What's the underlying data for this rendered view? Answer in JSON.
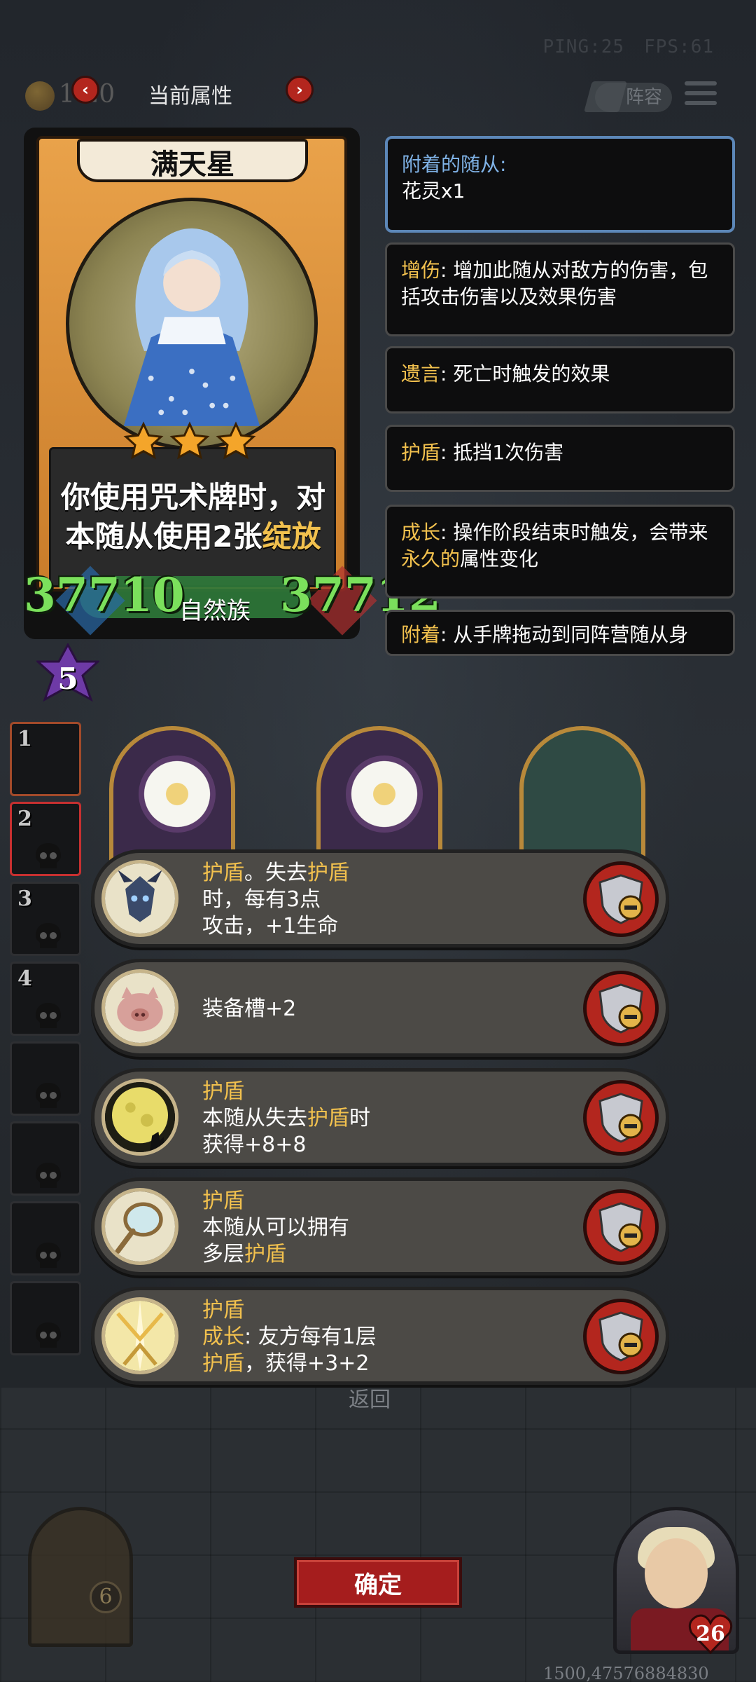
{
  "topbar": {
    "ping_label": "PING:25",
    "fps_label": "FPS:61",
    "coin_text": "1 20",
    "panel_title": "当前属性",
    "lineup_label": "阵容"
  },
  "card": {
    "name": "满天星",
    "stars": 3,
    "desc_line1": "你使用咒术牌时，对",
    "desc_line2_pre": "本随从使用2张",
    "desc_line2_hl": "绽放",
    "attack": "37710",
    "health": "37712",
    "tribe": "自然族"
  },
  "keywords": {
    "attached_title": "附着的随从:",
    "attached_value": "花灵x1",
    "damage_key": "增伤",
    "damage_desc": ": 增加此随从对敌方的伤害，包括攻击伤害以及效果伤害",
    "deathrattle_key": "遗言",
    "deathrattle_desc": ": 死亡时触发的效果",
    "shield_key": "护盾",
    "shield_desc": ": 抵挡1次伤害",
    "growth_key": "成长",
    "growth_desc_pre": ": 操作阶段结束时触发，会带来",
    "growth_desc_hl": "永久的",
    "growth_desc_post": "属性变化",
    "attach_key": "附着",
    "attach_desc": ": 从手牌拖动到同阵营随从身"
  },
  "level": "5",
  "slots": [
    {
      "num": "1"
    },
    {
      "num": "2"
    },
    {
      "num": "3"
    },
    {
      "num": "4"
    },
    {
      "num": ""
    },
    {
      "num": ""
    },
    {
      "num": ""
    },
    {
      "num": ""
    }
  ],
  "buffs": [
    {
      "icon": "demon-mask-icon",
      "l1_a": "护盾",
      "l1_b": "。失去",
      "l1_c": "护盾",
      "l2": "时，每有3点",
      "l3": "攻击，+1生命"
    },
    {
      "icon": "pig-icon",
      "l1": "装备槽+2"
    },
    {
      "icon": "moon-icon",
      "l1": "护盾",
      "l2_a": "本随从失去",
      "l2_b": "护盾",
      "l2_c": "时",
      "l3": "获得+8+8"
    },
    {
      "icon": "mirror-icon",
      "l1": "护盾",
      "l2": "本随从可以拥有",
      "l3_a": "多层",
      "l3_b": "护盾"
    },
    {
      "icon": "light-sword-icon",
      "l1": "护盾",
      "l2_a": "成长",
      "l2_b": ": 友方每有1层",
      "l3_a": "护盾",
      "l3_b": "，获得+3+2"
    }
  ],
  "back_label": "返回",
  "confirm_label": "确定",
  "door_count": "6",
  "hero_hp": "26",
  "coords_text": "1500,47576884830",
  "colors": {
    "highlight": "#f2c14e",
    "stat_green": "#7be05c",
    "button_red": "#a51d1d"
  }
}
